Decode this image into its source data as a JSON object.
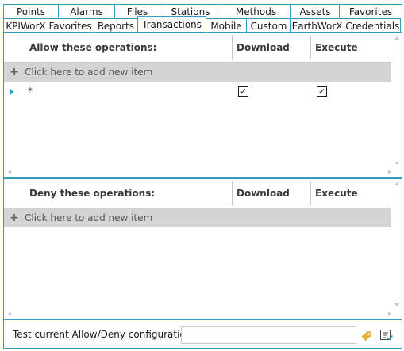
{
  "tabs": {
    "row1": [
      {
        "label": "Points"
      },
      {
        "label": "Alarms"
      },
      {
        "label": "Files"
      },
      {
        "label": "Stations"
      },
      {
        "label": "Methods"
      },
      {
        "label": "Assets"
      },
      {
        "label": "Favorites"
      }
    ],
    "row2": [
      {
        "label": "KPIWorX Favorites"
      },
      {
        "label": "Reports"
      },
      {
        "label": "Transactions",
        "active": true
      },
      {
        "label": "Mobile"
      },
      {
        "label": "Custom"
      },
      {
        "label": "EarthWorX Credentials"
      }
    ]
  },
  "allow_grid": {
    "col_operation": "Allow these operations:",
    "col_download": "Download",
    "col_execute": "Execute",
    "add_row": "Click here to add new item",
    "rows": [
      {
        "operation": "*",
        "download": true,
        "execute": true
      }
    ]
  },
  "deny_grid": {
    "col_operation": "Deny these operations:",
    "col_download": "Download",
    "col_execute": "Execute",
    "add_row": "Click here to add new item",
    "rows": []
  },
  "footer": {
    "test_label": "Test current Allow/Deny configuration:",
    "test_value": ""
  },
  "icons": {
    "tag": "tag-icon",
    "test": "test-config-icon"
  },
  "colors": {
    "accent": "#2f9dbd",
    "add_row_bg": "#d4d4d4"
  }
}
